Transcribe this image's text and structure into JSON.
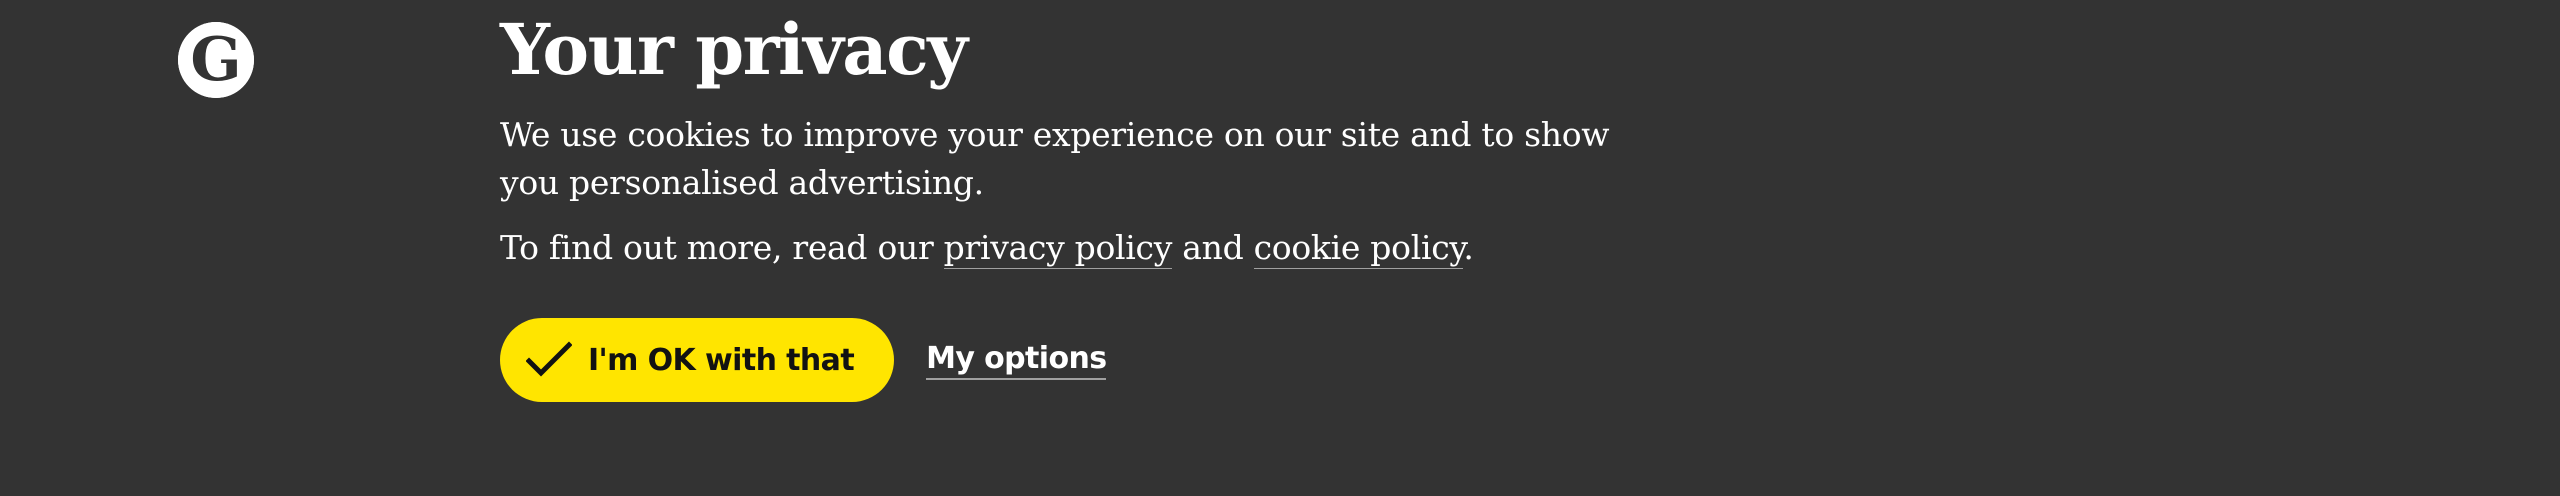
{
  "banner": {
    "logo": {
      "icon": "guardian-g-logo",
      "letter": "G"
    },
    "title": "Your privacy",
    "intro_text": "We use cookies to improve your experience on our site and to show you personalised advertising.",
    "more_text_prefix": "To find out more, read our ",
    "privacy_policy_link": "privacy policy",
    "more_text_and": " and ",
    "cookie_policy_link": "cookie policy",
    "more_text_suffix": ".",
    "accept_button": {
      "label": "I'm OK with that",
      "icon": "check-icon"
    },
    "options_button": {
      "label": "My options"
    }
  },
  "colors": {
    "background": "#333333",
    "text": "#ffffff",
    "accent": "#ffe500",
    "button_text": "#121212",
    "link_underline": "#a0a0a0"
  }
}
